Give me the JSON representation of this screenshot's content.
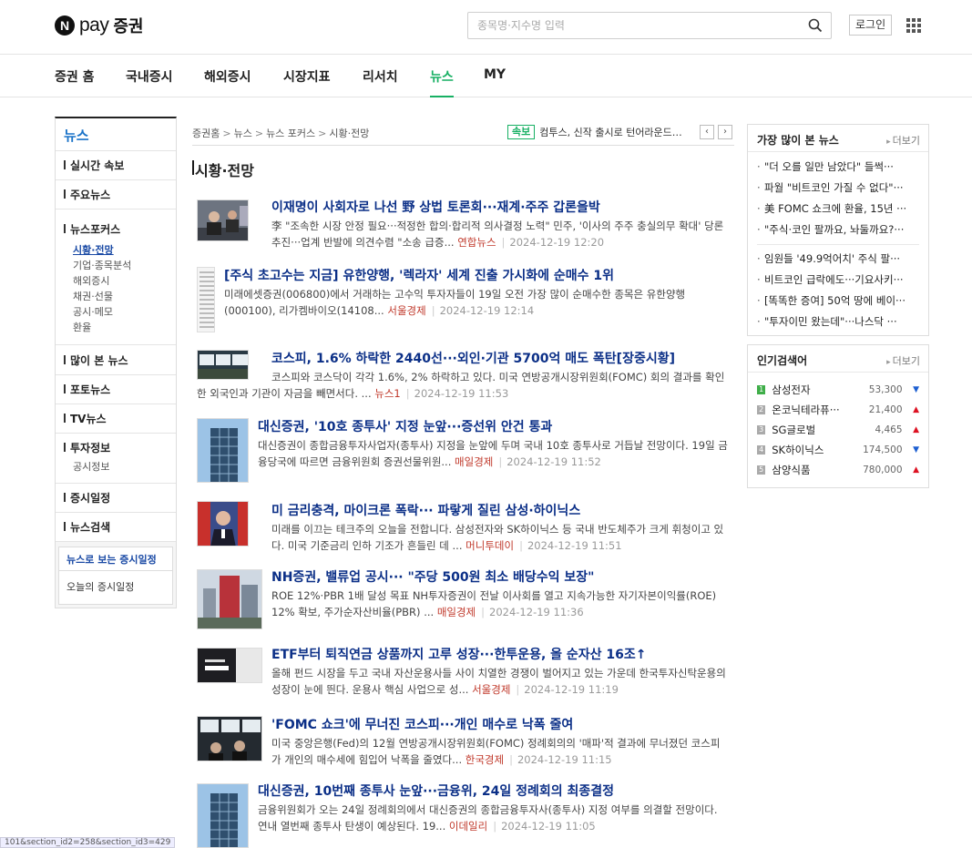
{
  "header": {
    "logo_pay": "pay",
    "logo_sec": "증권",
    "search_placeholder": "종목명·지수명 입력",
    "login": "로그인"
  },
  "gnb": [
    "증권 홈",
    "국내증시",
    "해외증시",
    "시장지표",
    "리서치",
    "뉴스",
    "MY"
  ],
  "lnb": {
    "title": "뉴스",
    "s1": "실시간 속보",
    "s2": "주요뉴스",
    "s3": "뉴스포커스",
    "s3_sub": [
      "시황·전망",
      "기업·종목분석",
      "해외증시",
      "채권·선물",
      "공시·메모",
      "환율"
    ],
    "s4": "많이 본 뉴스",
    "s5": "포토뉴스",
    "s6": "TV뉴스",
    "s7": "투자정보",
    "s7_sub": [
      "공시정보"
    ],
    "s8": "증시일정",
    "s9": "뉴스검색",
    "cal_title": "뉴스로 보는 증시일정",
    "cal_body": "오늘의 증시일정"
  },
  "breadcrumb": [
    "증권홈",
    "뉴스",
    "뉴스 포커스",
    "시황·전망"
  ],
  "breaking": {
    "badge": "속보",
    "text": "컴투스, 신작 출시로 턴어라운드 전..."
  },
  "section_title": "시황·전망",
  "articles": [
    {
      "title": "이재명이 사회자로 나선 野 상법 토론회···재계·주주 갑론을박",
      "desc": "李 \"조속한 시장 안정 필요···적정한 합의·합리적 의사결정 노력\" 민주, '이사의 주주 충실의무 확대' 당론추진···업계 반발에 의견수렴 \"소송 급증...",
      "press": "연합뉴스",
      "date": "2024-12-19 12:20"
    },
    {
      "title": "[주식 초고수는 지금] 유한양행, '렉라자' 세계 진출 가시화에 순매수 1위",
      "desc": "미래에셋증권(006800)에서 거래하는 고수익 투자자들이 19일 오전 가장 많이 순매수한 종목은 유한양행(000100), 리가켐바이오(14108...",
      "press": "서울경제",
      "date": "2024-12-19 12:14"
    },
    {
      "title": "코스피, 1.6% 하락한 2440선···외인·기관 5700억 매도 폭탄[장중시황]",
      "desc": "코스피와 코스닥이 각각 1.6%, 2% 하락하고 있다. 미국 연방공개시장위원회(FOMC) 회의 결과를 확인한 외국인과 기관이 자금을 빼면서다. ...",
      "press": "뉴스1",
      "date": "2024-12-19 11:53"
    },
    {
      "title": "대신증권, '10호 종투사' 지정 눈앞···증선위 안건 통과",
      "desc": "대신증권이 종합금융투자사업자(종투사) 지정을 눈앞에 두며 국내 10호 종투사로 거듭날 전망이다. 19일 금융당국에 따르면 금융위원회 증권선물위원...",
      "press": "매일경제",
      "date": "2024-12-19 11:52"
    },
    {
      "title": "미 금리충격, 마이크론 폭락··· 파랗게 질린 삼성·하이닉스",
      "desc": "미래를 이끄는 테크주의 오늘을 전합니다. 삼성전자와 SK하이닉스 등 국내 반도체주가 크게 휘청이고 있다. 미국 기준금리 인하 기조가 흔들린 데 ...",
      "press": "머니투데이",
      "date": "2024-12-19 11:51"
    },
    {
      "title": "NH증권, 밸류업 공시··· \"주당 500원 최소 배당수익 보장\"",
      "desc": "ROE 12%·PBR 1배 달성 목표 NH투자증권이 전날 이사회를 열고 지속가능한 자기자본이익률(ROE) 12% 확보, 주가순자산비율(PBR) ...",
      "press": "매일경제",
      "date": "2024-12-19 11:36"
    },
    {
      "title": "ETF부터 퇴직연금 상품까지 고루 성장···한투운용, 올 순자산 16조↑",
      "desc": "올해 펀드 시장을 두고 국내 자산운용사들 사이 치열한 경쟁이 벌어지고 있는 가운데 한국투자신탁운용의 성장이 눈에 띈다. 운용사 핵심 사업으로 성...",
      "press": "서울경제",
      "date": "2024-12-19 11:19"
    },
    {
      "title": "'FOMC 쇼크'에 무너진 코스피···개인 매수로 낙폭 줄여",
      "desc": "미국 중앙은행(Fed)의 12월 연방공개시장위원회(FOMC) 정례회의의 '매파'적 결과에 무너졌던 코스피가 개인의 매수세에 힘입어 낙폭을 줄였다...",
      "press": "한국경제",
      "date": "2024-12-19 11:15"
    },
    {
      "title": "대신증권, 10번째 종투사 눈앞···금융위, 24일 정례회의 최종결정",
      "desc": "금융위원회가 오는 24일 정례회의에서 대신증권의 종합금융투자사(종투사) 지정 여부를 의결할 전망이다. 연내 열번째 종투사 탄생이 예상된다. 19...",
      "press": "이데일리",
      "date": "2024-12-19 11:05"
    }
  ],
  "most_viewed": {
    "title": "가장 많이 본 뉴스",
    "more": "더보기",
    "items": [
      "\"더 오를 일만 남았다\" 들썩···",
      "파월 \"비트코인 가질 수 없다\"···",
      "美 FOMC 쇼크에 환율, 15년 ···",
      "\"주식·코인 팔까요, 놔둘까요?···",
      "임원들 '49.9억어치' 주식 팔···",
      "비트코인 급락에도···기요사키···",
      "[똑똑한 증여] 50억 땅에 베이···",
      "\"투자이민 왔는데\"···나스닥 ···"
    ]
  },
  "popular": {
    "title": "인기검색어",
    "more": "더보기",
    "items": [
      {
        "rank": "1",
        "name": "삼성전자",
        "price": "53,300",
        "dir": "▼",
        "cls": "down"
      },
      {
        "rank": "2",
        "name": "온코닉테라퓨···",
        "price": "21,400",
        "dir": "▲",
        "cls": "up"
      },
      {
        "rank": "3",
        "name": "SG글로벌",
        "price": "4,465",
        "dir": "▲",
        "cls": "up"
      },
      {
        "rank": "4",
        "name": "SK하이닉스",
        "price": "174,500",
        "dir": "▼",
        "cls": "down"
      },
      {
        "rank": "5",
        "name": "삼양식품",
        "price": "780,000",
        "dir": "▲",
        "cls": "up"
      }
    ]
  },
  "status_url": "101&section_id2=258&section_id3=429"
}
